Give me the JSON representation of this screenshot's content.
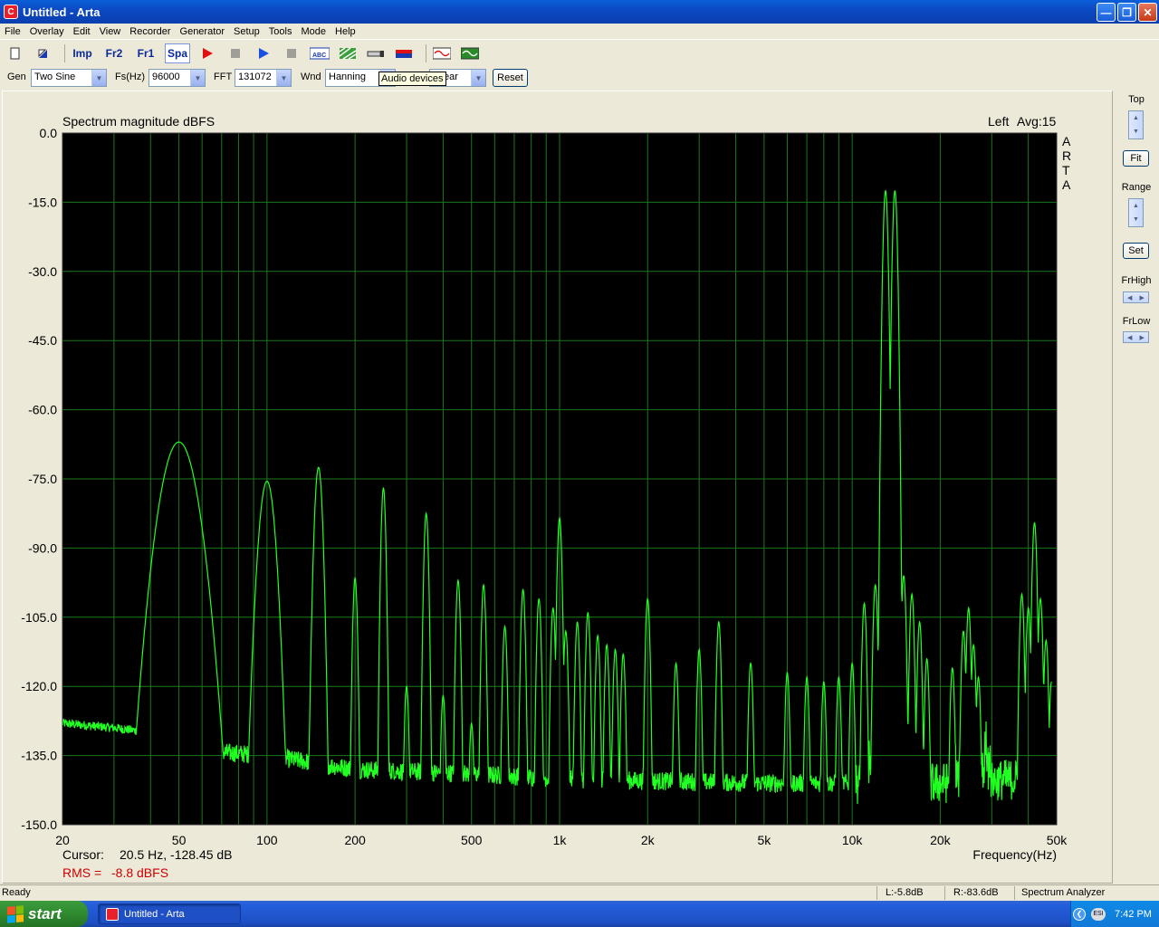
{
  "window": {
    "title": "Untitled - Arta",
    "app_icon_letter": "C"
  },
  "menu": [
    "File",
    "Overlay",
    "Edit",
    "View",
    "Recorder",
    "Generator",
    "Setup",
    "Tools",
    "Mode",
    "Help"
  ],
  "toolbar": {
    "imp": "Imp",
    "fr2": "Fr2",
    "fr1": "Fr1",
    "spa": "Spa"
  },
  "controls": {
    "gen_label": "Gen",
    "gen_value": "Two Sine",
    "fs_label": "Fs(Hz)",
    "fs_value": "96000",
    "fft_label": "FFT",
    "fft_value": "131072",
    "wnd_label": "Wnd",
    "wnd_value": "Hanning",
    "avg_value": "ear",
    "reset_label": "Reset"
  },
  "tooltip": "Audio devices",
  "chart_data": {
    "type": "line",
    "title": "Spectrum magnitude dBFS",
    "channel_label": "Left",
    "avg_label": "Avg:15",
    "side_label": [
      "A",
      "R",
      "T",
      "A"
    ],
    "xlabel": "Frequency(Hz)",
    "x_scale": "log",
    "xlim": [
      20,
      50000
    ],
    "ylim": [
      -150,
      0
    ],
    "x_ticks": [
      20,
      50,
      100,
      200,
      500,
      1000,
      2000,
      5000,
      10000,
      20000,
      50000
    ],
    "x_tick_labels": [
      "20",
      "50",
      "100",
      "200",
      "500",
      "1k",
      "2k",
      "5k",
      "10k",
      "20k",
      "50k"
    ],
    "y_ticks": [
      0,
      -15,
      -30,
      -45,
      -60,
      -75,
      -90,
      -105,
      -120,
      -135,
      -150
    ],
    "y_tick_labels": [
      "0.0",
      "-15.0",
      "-30.0",
      "-45.0",
      "-60.0",
      "-75.0",
      "-90.0",
      "-105.0",
      "-120.0",
      "-135.0",
      "-150.0"
    ],
    "grid": true,
    "colors": {
      "trace": "#22ff22",
      "plot_bg": "#000000",
      "grid": "#1a7a1a",
      "rms": "#cc0000"
    },
    "noise_floor": [
      [
        20,
        -128
      ],
      [
        30,
        -129
      ],
      [
        40,
        -130
      ],
      [
        50,
        -128
      ],
      [
        60,
        -134
      ],
      [
        100,
        -135
      ],
      [
        200,
        -138
      ],
      [
        500,
        -139
      ],
      [
        1000,
        -140
      ],
      [
        2000,
        -140.5
      ],
      [
        5000,
        -141
      ],
      [
        10000,
        -141
      ],
      [
        20000,
        -141
      ],
      [
        40000,
        -140
      ],
      [
        48000,
        -138
      ]
    ],
    "peaks": [
      {
        "f": 50,
        "db": -67,
        "w": 0.045
      },
      {
        "f": 100,
        "db": -75.5,
        "w": 0.02
      },
      {
        "f": 150,
        "db": -72.5,
        "w": 0.01
      },
      {
        "f": 200,
        "db": -96.5
      },
      {
        "f": 250,
        "db": -77
      },
      {
        "f": 300,
        "db": -120
      },
      {
        "f": 350,
        "db": -82.5
      },
      {
        "f": 400,
        "db": -122
      },
      {
        "f": 450,
        "db": -97
      },
      {
        "f": 500,
        "db": -128
      },
      {
        "f": 550,
        "db": -98
      },
      {
        "f": 650,
        "db": -107
      },
      {
        "f": 750,
        "db": -99
      },
      {
        "f": 850,
        "db": -101
      },
      {
        "f": 950,
        "db": -103
      },
      {
        "f": 1000,
        "db": -83.5
      },
      {
        "f": 1050,
        "db": -108
      },
      {
        "f": 1150,
        "db": -106
      },
      {
        "f": 1250,
        "db": -104
      },
      {
        "f": 1350,
        "db": -109
      },
      {
        "f": 1450,
        "db": -111
      },
      {
        "f": 1550,
        "db": -112
      },
      {
        "f": 1650,
        "db": -113
      },
      {
        "f": 2000,
        "db": -101
      },
      {
        "f": 2500,
        "db": -115
      },
      {
        "f": 3000,
        "db": -112
      },
      {
        "f": 3500,
        "db": -106
      },
      {
        "f": 4500,
        "db": -115
      },
      {
        "f": 6000,
        "db": -117
      },
      {
        "f": 7000,
        "db": -118
      },
      {
        "f": 8000,
        "db": -119
      },
      {
        "f": 9000,
        "db": -118
      },
      {
        "f": 10000,
        "db": -115
      },
      {
        "f": 11000,
        "db": -102
      },
      {
        "f": 12000,
        "db": -98
      },
      {
        "f": 13000,
        "db": -12.5
      },
      {
        "f": 14000,
        "db": -12.5
      },
      {
        "f": 15000,
        "db": -96
      },
      {
        "f": 16000,
        "db": -100
      },
      {
        "f": 17000,
        "db": -106
      },
      {
        "f": 18000,
        "db": -114
      },
      {
        "f": 22000,
        "db": -116
      },
      {
        "f": 24000,
        "db": -108
      },
      {
        "f": 25000,
        "db": -103
      },
      {
        "f": 26000,
        "db": -111
      },
      {
        "f": 27000,
        "db": -118
      },
      {
        "f": 38000,
        "db": -100
      },
      {
        "f": 40000,
        "db": -103
      },
      {
        "f": 42000,
        "db": -84.5
      },
      {
        "f": 44000,
        "db": -101
      },
      {
        "f": 46000,
        "db": -110
      },
      {
        "f": 48000,
        "db": -119
      }
    ],
    "cursor_label": "Cursor:",
    "cursor_value": "20.5 Hz, -128.45 dB",
    "rms_label": "RMS =",
    "rms_value": "-8.8 dBFS"
  },
  "right_panel": {
    "top_label": "Top",
    "fit_label": "Fit",
    "range_label": "Range",
    "set_label": "Set",
    "frhigh_label": "FrHigh",
    "frlow_label": "FrLow"
  },
  "status": {
    "ready": "Ready",
    "left_level": "L:-5.8dB",
    "right_level": "R:-83.6dB",
    "mode": "Spectrum Analyzer"
  },
  "taskbar": {
    "start_label": "start",
    "task_label": "Untitled - Arta",
    "clock": "7:42 PM",
    "tray_icon_text": "ESI"
  }
}
